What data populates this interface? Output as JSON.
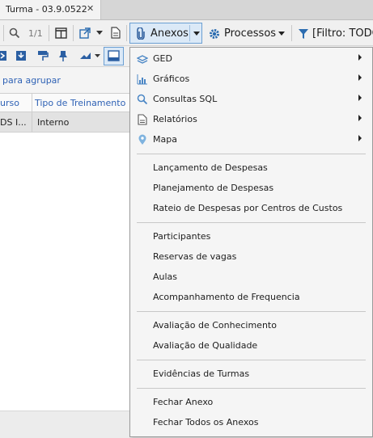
{
  "tab": {
    "title": "Turma - 03.9.0522",
    "close": "✕"
  },
  "toolbar": {
    "pager": "1/1",
    "anexos": "Anexos",
    "processos": "Processos",
    "filtro": "[Filtro: TODO"
  },
  "grid": {
    "group_hint": "para agrupar",
    "columns": [
      "urso",
      "Tipo de Treinamento"
    ],
    "row": [
      "DS I...",
      "Interno"
    ]
  },
  "menu": {
    "submenus": [
      {
        "label": "GED",
        "icon": "ged-icon"
      },
      {
        "label": "Gráficos",
        "icon": "chart-icon"
      },
      {
        "label": "Consultas SQL",
        "icon": "search-icon"
      },
      {
        "label": "Relatórios",
        "icon": "document-icon"
      },
      {
        "label": "Mapa",
        "icon": "map-pin-icon"
      }
    ],
    "group2": [
      "Lançamento de Despesas",
      "Planejamento de Despesas",
      "Rateio de Despesas por Centros de Custos"
    ],
    "group3": [
      "Participantes",
      "Reservas de vagas",
      "Aulas",
      "Acompanhamento de Frequencia"
    ],
    "group4": [
      "Avaliação de Conhecimento",
      "Avaliação de Qualidade"
    ],
    "group5": [
      "Evidências de Turmas"
    ],
    "group6": [
      "Fechar Anexo",
      "Fechar Todos os Anexos"
    ]
  },
  "colors": {
    "accent_blue": "#2f62b5",
    "selected_bg": "#dbe9f7",
    "selected_border": "#6b9fd3"
  }
}
